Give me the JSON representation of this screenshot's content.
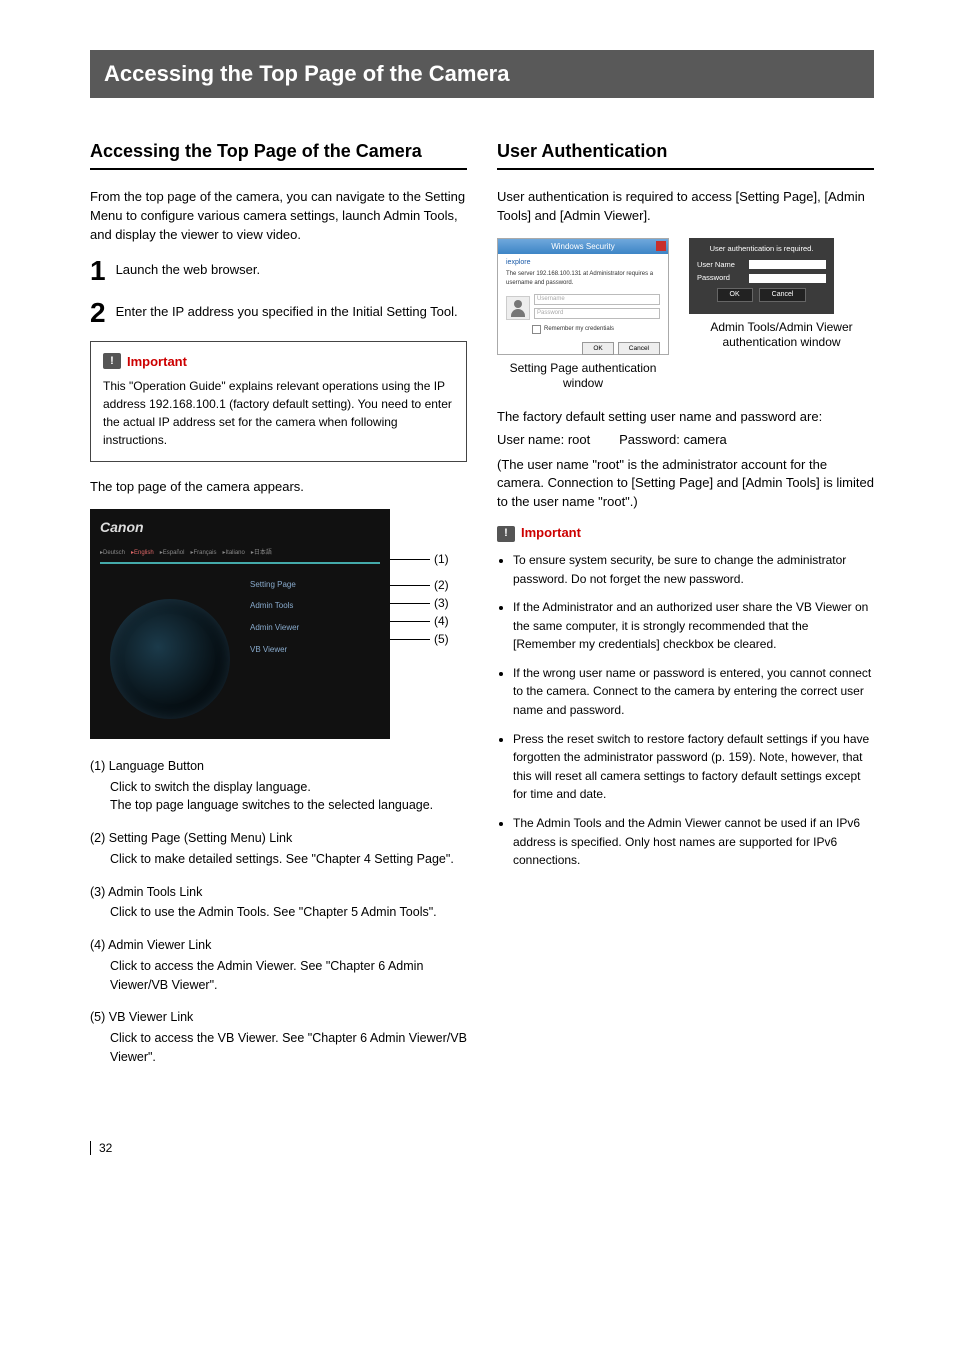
{
  "page_title": "Accessing the Top Page of the Camera",
  "left": {
    "heading": "Accessing the Top Page of the Camera",
    "intro": "From the top page of the camera, you can navigate to the Setting Menu to configure various camera settings, launch Admin Tools, and display the viewer to view video.",
    "steps": [
      {
        "num": "1",
        "text": "Launch the web browser."
      },
      {
        "num": "2",
        "text": "Enter the IP address you specified in the Initial Setting Tool."
      }
    ],
    "important_label": "Important",
    "important_text": "This \"Operation Guide\" explains relevant operations using the IP address 192.168.100.1 (factory default setting). You need to enter the actual IP address set for the camera when following instructions.",
    "after_important": "The top page of the camera appears.",
    "top_page_ui": {
      "brand": "Canon",
      "languages": [
        "▸Deutsch",
        "▸English",
        "▸Español",
        "▸Français",
        "▸Italiano",
        "▸日本語"
      ],
      "active_lang_index": 1,
      "links": [
        "Setting Page",
        "Admin Tools",
        "Admin Viewer",
        "VB Viewer"
      ]
    },
    "callouts": [
      "(1)",
      "(2)",
      "(3)",
      "(4)",
      "(5)"
    ],
    "annotations": [
      {
        "num": "(1)",
        "title": "Language Button",
        "desc": "Click to switch the display language.\nThe top page language switches to the selected language."
      },
      {
        "num": "(2)",
        "title": "Setting Page (Setting Menu) Link",
        "desc": "Click to make detailed settings. See \"Chapter 4 Setting Page\"."
      },
      {
        "num": "(3)",
        "title": "Admin Tools Link",
        "desc": "Click to use the Admin Tools. See \"Chapter 5 Admin Tools\"."
      },
      {
        "num": "(4)",
        "title": "Admin Viewer Link",
        "desc": "Click to access the Admin Viewer. See \"Chapter 6 Admin Viewer/VB Viewer\"."
      },
      {
        "num": "(5)",
        "title": "VB Viewer Link",
        "desc": "Click to access the VB Viewer. See \"Chapter 6 Admin Viewer/VB Viewer\"."
      }
    ]
  },
  "right": {
    "heading": "User Authentication",
    "intro": "User authentication is required to access [Setting Page], [Admin Tools] and [Admin Viewer].",
    "win1": {
      "title": "Windows Security",
      "app": "iexplore",
      "sub": "The server 192.168.100.131 at Administrator requires a username and password.",
      "placeholder_user": "Username",
      "placeholder_pass": "Password",
      "remember": "Remember my credentials",
      "ok": "OK",
      "cancel": "Cancel",
      "caption": "Setting Page authentication window"
    },
    "win2": {
      "title": "User authentication is required.",
      "label_user": "User Name",
      "label_pass": "Password",
      "ok": "OK",
      "cancel": "Cancel",
      "caption": "Admin Tools/Admin Viewer authentication window"
    },
    "defaults_line1": "The factory default setting user name and password are:",
    "defaults_user_label": "User name: ",
    "defaults_user": "root",
    "defaults_pass_label": "Password: ",
    "defaults_pass": "camera",
    "defaults_note": "(The user name \"root\" is the administrator account for the camera. Connection to [Setting Page] and [Admin Tools] is limited to the user name \"root\".)",
    "important_label": "Important",
    "bullets": [
      "To ensure system security, be sure to change the administrator password. Do not forget the new password.",
      "If the Administrator and an authorized user share the VB Viewer on the same computer, it is strongly recommended that the [Remember my credentials] checkbox be cleared.",
      "If the wrong user name or password is entered, you cannot connect to the camera. Connect to the camera by entering the correct user name and password.",
      "Press the reset switch to restore factory default settings if you have forgotten the administrator password (p. 159). Note, however, that this will reset all camera settings to factory default settings except for time and date.",
      "The Admin Tools and the Admin Viewer cannot be used if an IPv6 address is specified. Only host names are supported for IPv6 connections."
    ]
  },
  "page_number": "32"
}
